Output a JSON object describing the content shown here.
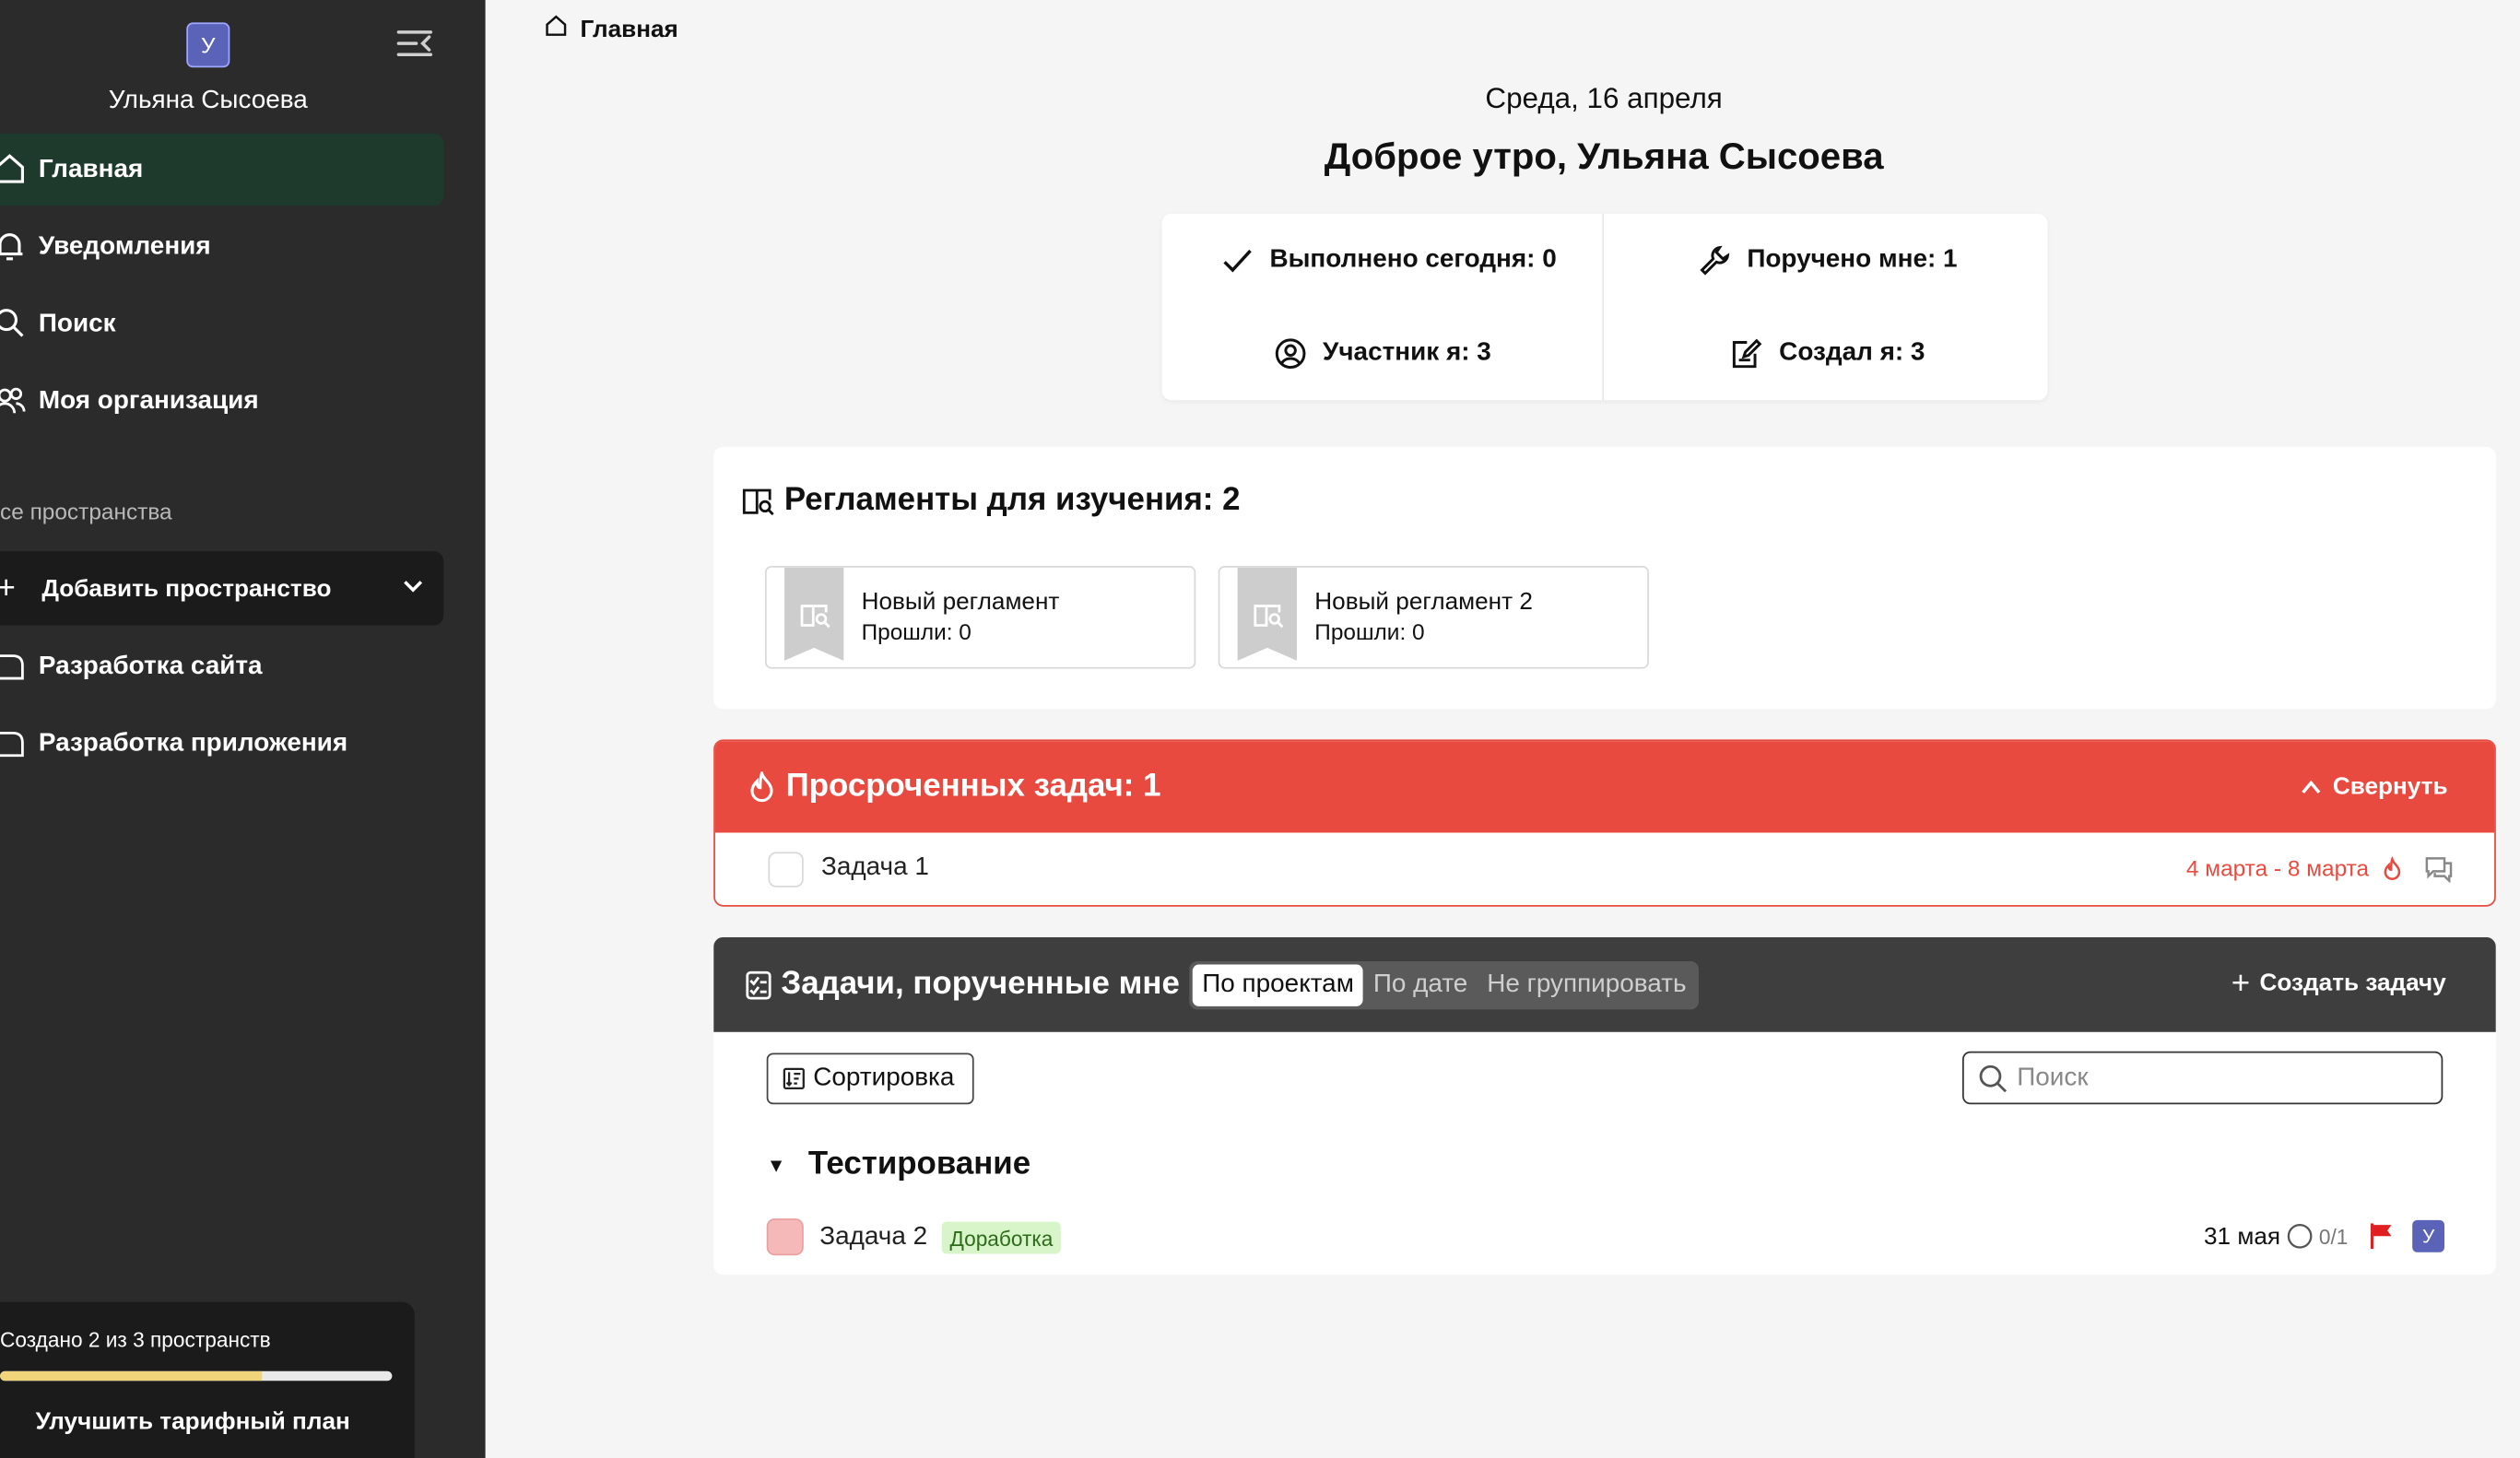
{
  "user": {
    "initial": "У",
    "name": "Ульяна Сысоева"
  },
  "sidebar": {
    "nav": [
      {
        "label": "Главная",
        "icon": "home-icon",
        "active": true
      },
      {
        "label": "Уведомления",
        "icon": "bell-icon"
      },
      {
        "label": "Поиск",
        "icon": "search-icon"
      },
      {
        "label": "Моя организация",
        "icon": "users-icon"
      }
    ],
    "section_label": "се пространства",
    "add_space": "Добавить пространство",
    "spaces": [
      "Разработка сайта",
      "Разработка приложения"
    ],
    "plan": {
      "text": "Создано 2 из 3 пространств",
      "used": 2,
      "total": 3,
      "upgrade": "Улучшить тарифный план"
    }
  },
  "breadcrumb": "Главная",
  "header": {
    "date": "Среда, 16 апреля",
    "greeting": "Доброе утро, Ульяна Сысоева"
  },
  "stats": {
    "done_today": "Выполнено сегодня: 0",
    "assigned": "Поручено мне: 1",
    "member": "Участник я: 3",
    "created": "Создал я: 3"
  },
  "regulations": {
    "title": "Регламенты для изучения: 2",
    "items": [
      {
        "name": "Новый регламент",
        "passed": "Прошли: 0"
      },
      {
        "name": "Новый регламент 2",
        "passed": "Прошли: 0"
      }
    ]
  },
  "overdue": {
    "title": "Просроченных задач: 1",
    "collapse": "Свернуть",
    "tasks": [
      {
        "name": "Задача 1",
        "dates": "4 марта - 8 марта"
      }
    ]
  },
  "assigned_tasks": {
    "title": "Задачи, порученные мне",
    "grouping": [
      "По проектам",
      "По дате",
      "Не группировать"
    ],
    "grouping_selected": "По проектам",
    "create": "Создать задачу",
    "sort": "Сортировка",
    "search_placeholder": "Поиск",
    "group": "Тестирование",
    "tasks": [
      {
        "name": "Задача 2",
        "tag": "Доработка",
        "date": "31 мая",
        "subtasks": "0/1",
        "assignee": "У"
      }
    ]
  },
  "colors": {
    "accent_red": "#e84a3f",
    "sidebar_bg": "#2b2b2b",
    "active_nav": "#1e3a2c",
    "avatar": "#5a63b8"
  }
}
